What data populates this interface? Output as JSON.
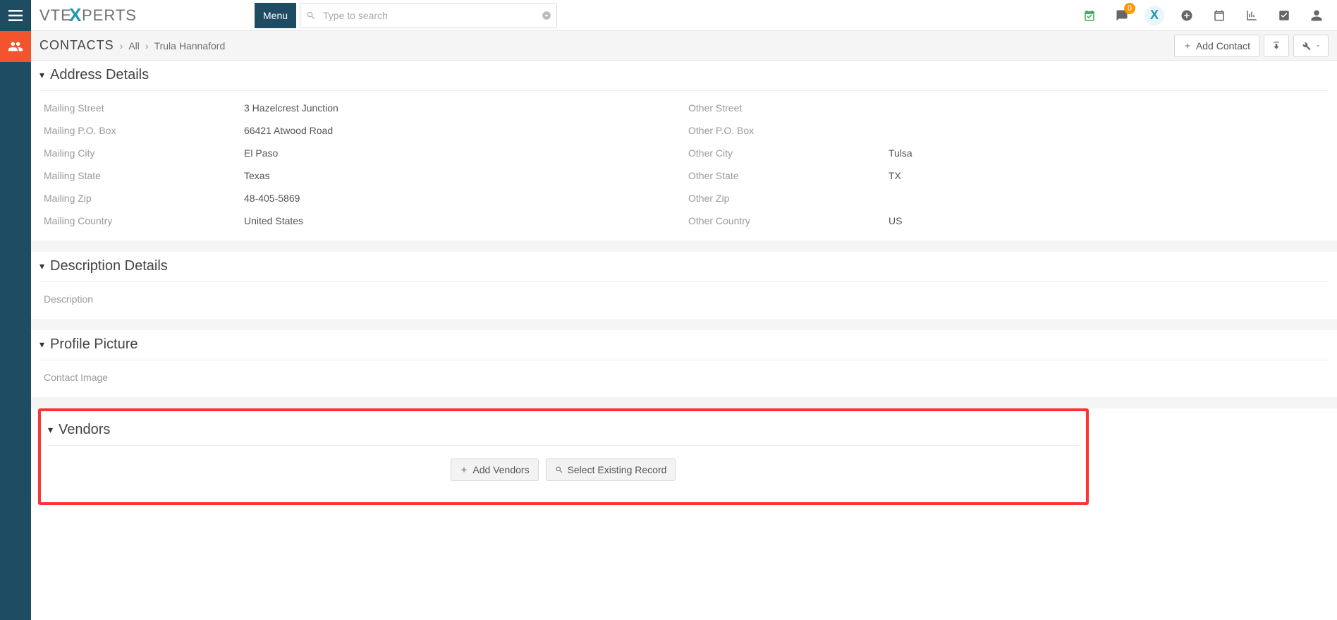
{
  "topbar": {
    "menu_label": "Menu",
    "search_placeholder": "Type to search",
    "notif_count": "0"
  },
  "breadcrumb": {
    "module": "CONTACTS",
    "link1": "All",
    "leaf": "Trula Hannaford",
    "add_label": "Add Contact"
  },
  "sections": {
    "address": {
      "title": "Address Details",
      "fields": {
        "mailing_street_l": "Mailing Street",
        "mailing_street_v": "3 Hazelcrest Junction",
        "other_street_l": "Other Street",
        "other_street_v": "",
        "mailing_po_l": "Mailing P.O. Box",
        "mailing_po_v": "66421 Atwood Road",
        "other_po_l": "Other P.O. Box",
        "other_po_v": "",
        "mailing_city_l": "Mailing City",
        "mailing_city_v": "El Paso",
        "other_city_l": "Other City",
        "other_city_v": "Tulsa",
        "mailing_state_l": "Mailing State",
        "mailing_state_v": "Texas",
        "other_state_l": "Other State",
        "other_state_v": "TX",
        "mailing_zip_l": "Mailing Zip",
        "mailing_zip_v": "48-405-5869",
        "other_zip_l": "Other Zip",
        "other_zip_v": "",
        "mailing_country_l": "Mailing Country",
        "mailing_country_v": "United States",
        "other_country_l": "Other Country",
        "other_country_v": "US"
      }
    },
    "description": {
      "title": "Description Details",
      "field_l": "Description",
      "field_v": ""
    },
    "profile": {
      "title": "Profile Picture",
      "field_l": "Contact Image",
      "field_v": ""
    },
    "vendors": {
      "title": "Vendors",
      "add_label": "Add Vendors",
      "select_label": "Select Existing Record"
    }
  }
}
